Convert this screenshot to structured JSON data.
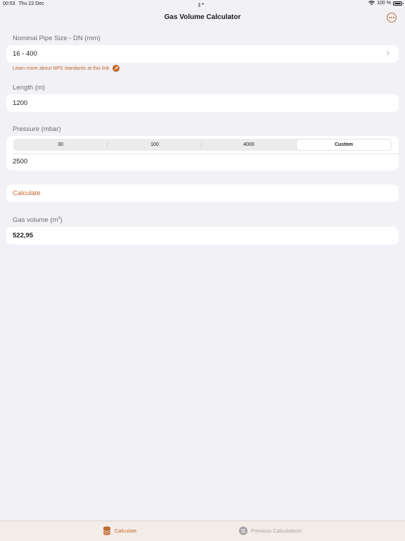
{
  "status_bar": {
    "time": "00:53",
    "date": "Thu 22 Dec",
    "battery": "100 %"
  },
  "nav": {
    "title": "Gas Volume Calculator",
    "more_icon": "ellipsis-circle-icon"
  },
  "pipe_size": {
    "label": "Nominal Pipe Size - DN (mm)",
    "value": "16 - 400",
    "link_text": "Learn more about NPS standards at this link"
  },
  "length": {
    "label": "Length (m)",
    "value": "1200"
  },
  "pressure": {
    "label": "Pressure (mbar)",
    "segments": [
      "30",
      "100",
      "4000",
      "Custom"
    ],
    "selected": "Custom",
    "value": "2500"
  },
  "calculate": {
    "label": "Calculate"
  },
  "result": {
    "label": "Gas volume (m",
    "unit_superscript": "3",
    "label_suffix": ")",
    "value": "522,95"
  },
  "tab_bar": {
    "tabs": [
      {
        "label": "Calculate",
        "icon": "cylinder-stack-icon",
        "active": true
      },
      {
        "label": "Previous Calculations",
        "icon": "list-circle-icon",
        "active": false
      }
    ]
  },
  "colors": {
    "accent": "#c06a2e",
    "background": "#f2f1f6",
    "card": "#ffffff",
    "tab_bar": "#f4ece7",
    "inactive": "#a3a3a8"
  }
}
